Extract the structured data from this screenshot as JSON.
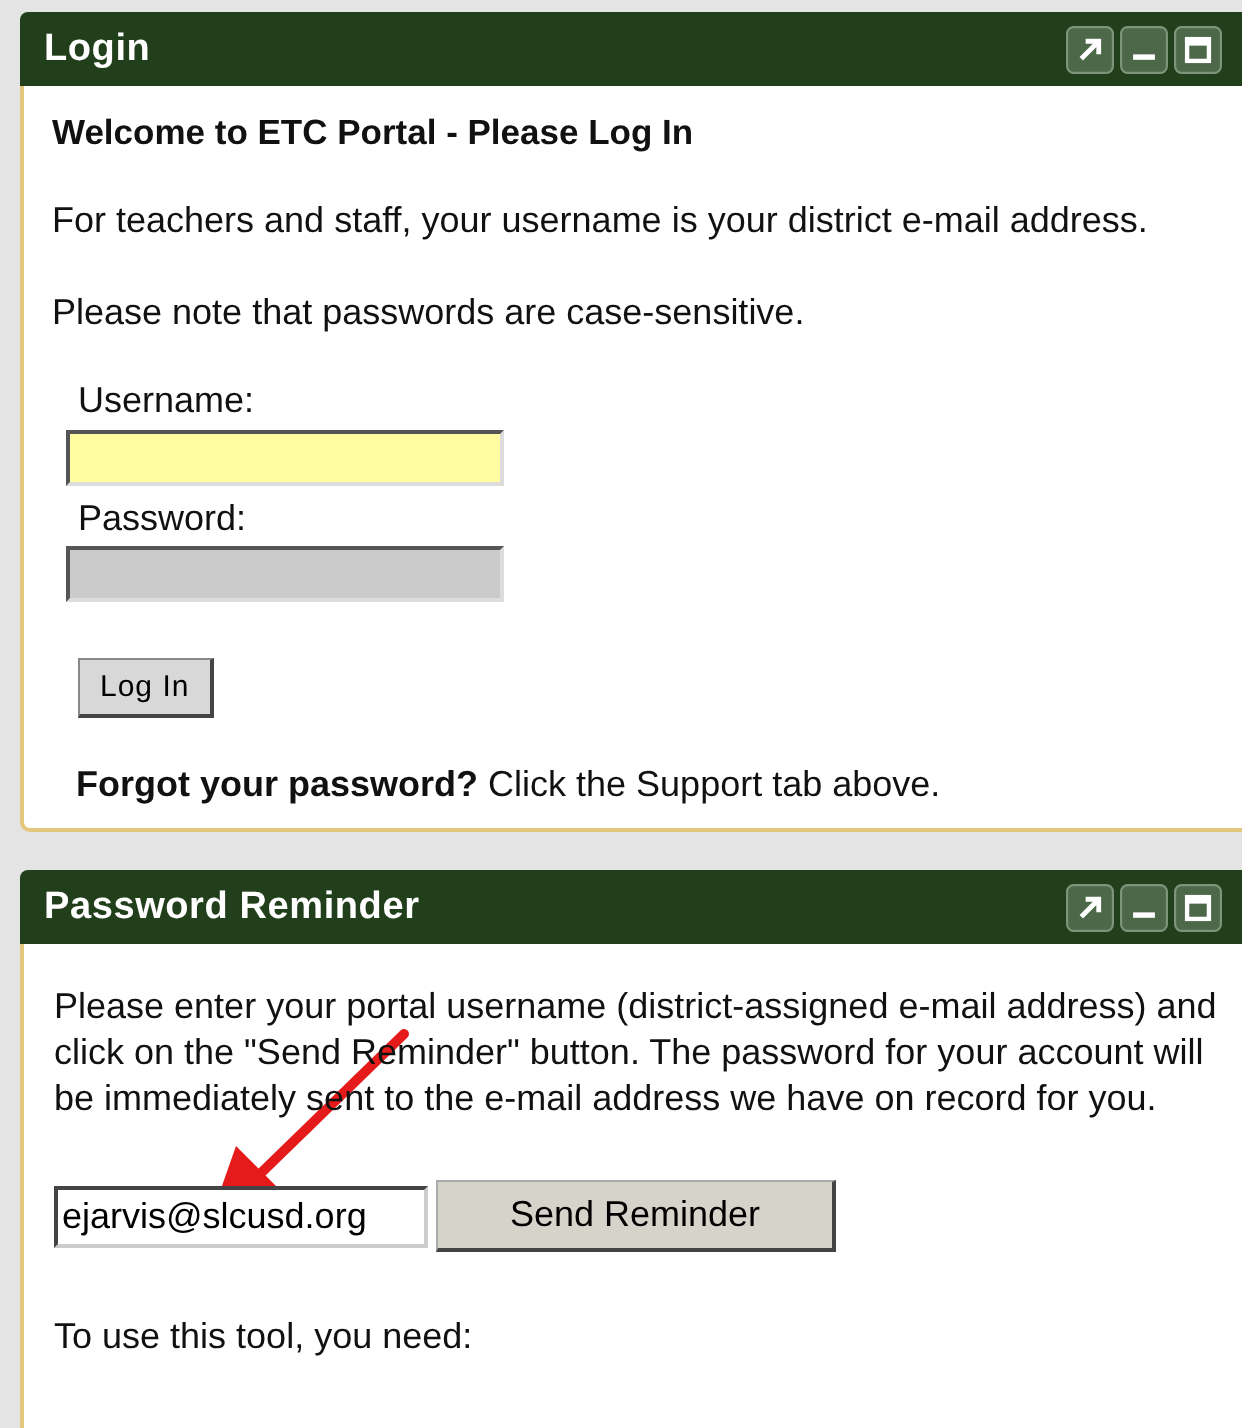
{
  "panels": [
    {
      "title": "Login",
      "blocks": [
        {
          "kind": "heading",
          "text": "Welcome to ETC Portal - Please Log In"
        },
        {
          "kind": "paragraph",
          "text": "For teachers and staff, your username is your district e-mail address."
        },
        {
          "kind": "paragraph",
          "text": "Please note that passwords are case-sensitive."
        },
        {
          "kind": "field",
          "label": "Username:",
          "focused": true
        },
        {
          "kind": "field",
          "label": "Password:",
          "focused": false
        },
        {
          "kind": "button",
          "text": "Log In"
        },
        {
          "kind": "note",
          "text": "**Forgot your password?** Click the Support tab above."
        }
      ]
    },
    {
      "title": "Password Reminder",
      "blocks": [
        {
          "kind": "paragraph",
          "text": "Please enter your portal username (district-assigned e-mail address) and click on the \"Send Reminder\" button. The password for your account will be immediately sent to the e-mail address we have on record for you."
        },
        {
          "kind": "email-row",
          "value": "ejarvis@slcusd.org",
          "button": "Send Reminder"
        },
        {
          "kind": "paragraph",
          "text": "To use this tool, you need:"
        }
      ],
      "annotation": {
        "kind": "arrow"
      }
    }
  ]
}
